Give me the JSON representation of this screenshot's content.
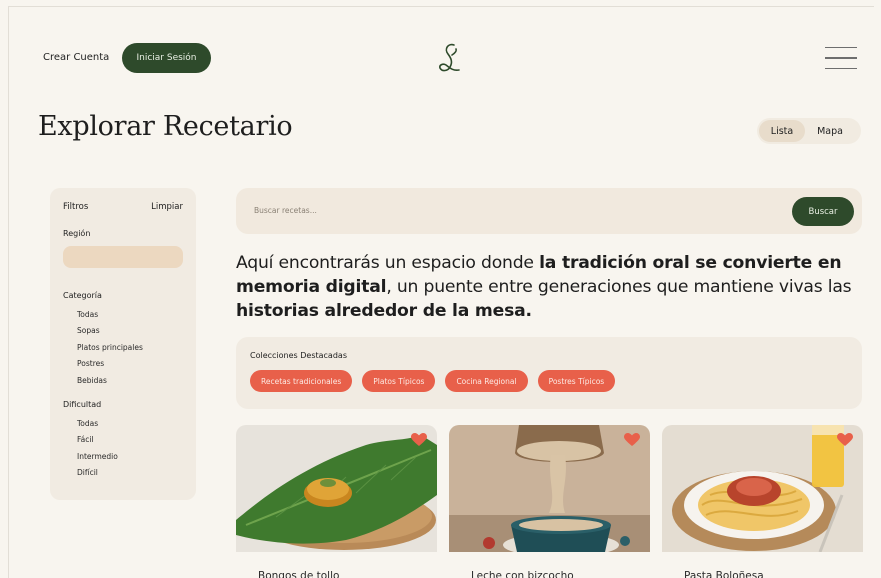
{
  "header": {
    "create_account": "Crear Cuenta",
    "login": "Iniciar Sesión"
  },
  "page": {
    "title": "Explorar Recetario"
  },
  "view_toggle": {
    "list": "Lista",
    "map": "Mapa"
  },
  "filters": {
    "title": "Filtros",
    "clear": "Limpiar",
    "region_label": "Región",
    "category_label": "Categoría",
    "categories": [
      "Todas",
      "Sopas",
      "Platos principales",
      "Postres",
      "Bebidas"
    ],
    "difficulty_label": "Dificultad",
    "difficulties": [
      "Todas",
      "Fácil",
      "Intermedio",
      "Difícil"
    ]
  },
  "search": {
    "placeholder": "Buscar recetas...",
    "button": "Buscar"
  },
  "intro": {
    "part1": "Aquí encontrarás un espacio donde ",
    "bold1": "la tradición oral se convierte en memoria digital",
    "part2": ", un puente entre generaciones que mantiene vivas las ",
    "bold2": "historias alrededor de la mesa."
  },
  "collections": {
    "title": "Colecciones Destacadas",
    "chips": [
      "Recetas tradicionales",
      "Platos Típicos",
      "Cocina Regional",
      "Postres Típicos"
    ]
  },
  "recipes": [
    {
      "title": "Bongos de tollo"
    },
    {
      "title": "Leche con bizcocho"
    },
    {
      "title": "Pasta Boloñesa"
    }
  ],
  "colors": {
    "primary_green": "#2e4a2b",
    "accent_coral": "#e8604a",
    "background": "#f8f5ef",
    "panel": "#f1ebe2"
  }
}
